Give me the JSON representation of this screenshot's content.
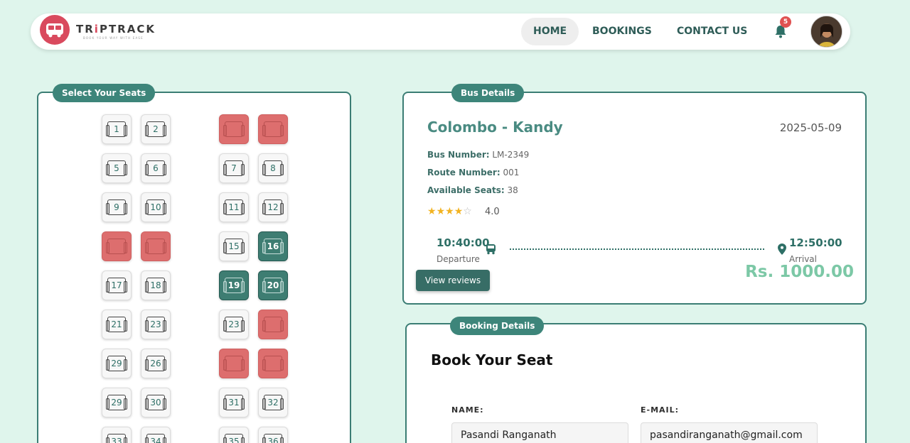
{
  "navbar": {
    "brand_pre": "TR",
    "brand_dot": "i",
    "brand_post": "PTRACK",
    "tagline": "BOOK YOUR WAY WITH EASE",
    "links": [
      "HOME",
      "BOOKINGS",
      "CONTACT US"
    ],
    "notification_count": "5"
  },
  "seats_panel": {
    "title": "Select Your Seats",
    "seats": [
      {
        "label": "1",
        "status": "available"
      },
      {
        "label": "2",
        "status": "available"
      },
      {
        "label": "",
        "status": "booked"
      },
      {
        "label": "",
        "status": "booked"
      },
      {
        "label": "5",
        "status": "available"
      },
      {
        "label": "6",
        "status": "available"
      },
      {
        "label": "7",
        "status": "available"
      },
      {
        "label": "8",
        "status": "available"
      },
      {
        "label": "9",
        "status": "available"
      },
      {
        "label": "10",
        "status": "available"
      },
      {
        "label": "11",
        "status": "available"
      },
      {
        "label": "12",
        "status": "available"
      },
      {
        "label": "",
        "status": "booked"
      },
      {
        "label": "",
        "status": "booked"
      },
      {
        "label": "15",
        "status": "available"
      },
      {
        "label": "16",
        "status": "selected"
      },
      {
        "label": "17",
        "status": "available"
      },
      {
        "label": "18",
        "status": "available"
      },
      {
        "label": "19",
        "status": "selected"
      },
      {
        "label": "20",
        "status": "selected"
      },
      {
        "label": "21",
        "status": "available"
      },
      {
        "label": "23",
        "status": "available"
      },
      {
        "label": "23",
        "status": "available"
      },
      {
        "label": "",
        "status": "booked"
      },
      {
        "label": "29",
        "status": "available"
      },
      {
        "label": "26",
        "status": "available"
      },
      {
        "label": "",
        "status": "booked"
      },
      {
        "label": "",
        "status": "booked"
      },
      {
        "label": "29",
        "status": "available"
      },
      {
        "label": "30",
        "status": "available"
      },
      {
        "label": "31",
        "status": "available"
      },
      {
        "label": "32",
        "status": "available"
      },
      {
        "label": "33",
        "status": "available"
      },
      {
        "label": "34",
        "status": "available"
      },
      {
        "label": "35",
        "status": "available"
      },
      {
        "label": "36",
        "status": "available"
      }
    ]
  },
  "bus_details": {
    "title": "Bus Details",
    "route": "Colombo - Kandy",
    "date": "2025-05-09",
    "bus_number_label": "Bus Number:",
    "bus_number": "LM-2349",
    "route_number_label": "Route Number:",
    "route_number": "001",
    "available_seats_label": "Available Seats:",
    "available_seats": "38",
    "rating": "4.0",
    "rating_value": 4,
    "departure_time": "10:40:00",
    "departure_label": "Departure",
    "arrival_time": "12:50:00",
    "arrival_label": "Arrival",
    "price": "Rs. 1000.00",
    "reviews_button": "View reviews"
  },
  "booking": {
    "title": "Booking Details",
    "heading": "Book Your Seat",
    "name_label": "NAME:",
    "name_value": "Pasandi Ranganath",
    "email_label": "E-MAIL:",
    "email_value": "pasandiranganath@gmail.com"
  },
  "colors": {
    "background": "#dff5ec",
    "accent": "#3d857a",
    "booked": "#dd6e6e",
    "selected": "#3e7d72",
    "price": "#7cc8a6"
  }
}
